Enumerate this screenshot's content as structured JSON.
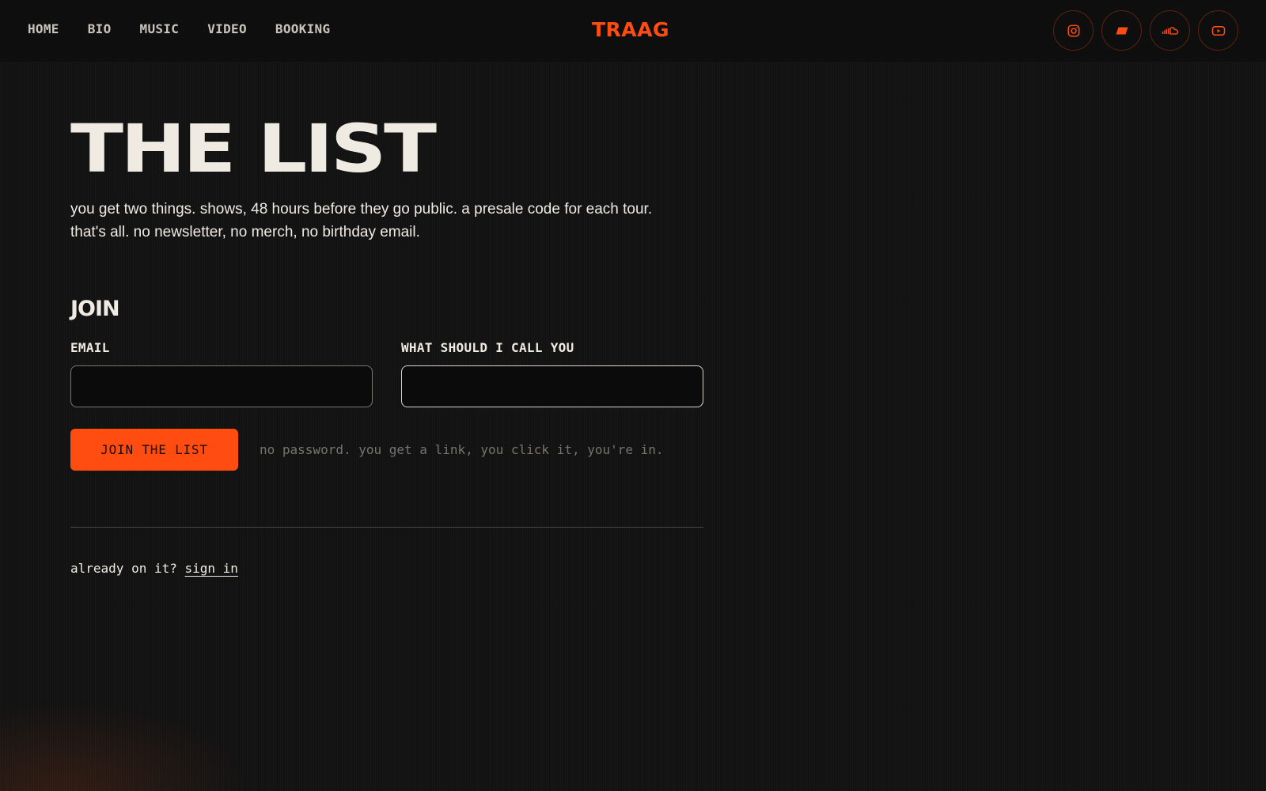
{
  "nav": {
    "items": [
      {
        "label": "HOME"
      },
      {
        "label": "BIO"
      },
      {
        "label": "MUSIC"
      },
      {
        "label": "VIDEO"
      },
      {
        "label": "BOOKING"
      }
    ]
  },
  "brand": {
    "logo_text": "TRAAG",
    "accent_color": "#ff4d12"
  },
  "social": {
    "icons": [
      "instagram-icon",
      "bandcamp-icon",
      "soundcloud-icon",
      "youtube-icon"
    ]
  },
  "page": {
    "title": "THE LIST",
    "intro_line_1": "you get two things. shows, 48 hours before they go public. a presale code for each tour.",
    "intro_line_2": "that's all. no newsletter, no merch, no birthday email."
  },
  "form": {
    "heading": "JOIN",
    "email_label": "EMAIL",
    "email_value": "",
    "name_label": "WHAT SHOULD I CALL YOU",
    "name_value": "",
    "submit_label": "JOIN THE LIST",
    "hint": "no password. you get a link, you click it, you're in."
  },
  "signin": {
    "prompt": "already on it?",
    "link_label": "sign in"
  }
}
